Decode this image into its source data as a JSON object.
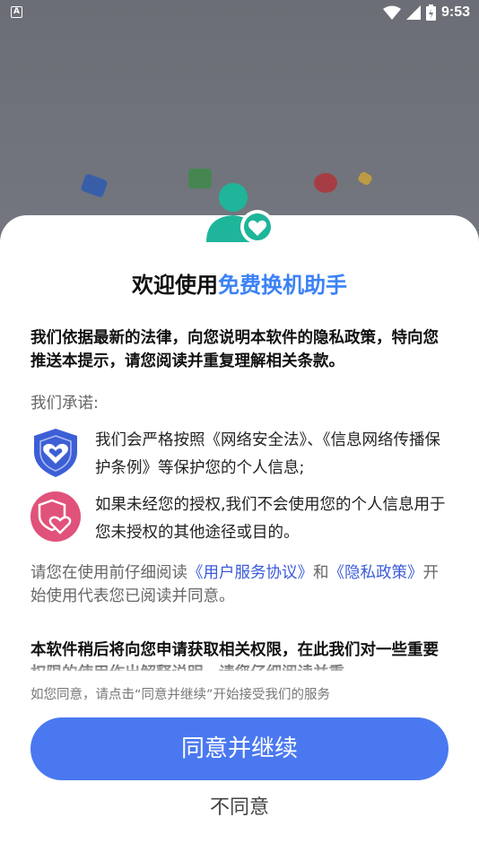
{
  "status_bar": {
    "time": "9:53",
    "notification_icon_label": "A"
  },
  "dialog": {
    "title_prefix": "欢迎使用",
    "title_app_name": "免费换机助手",
    "intro": "我们依据最新的法律，向您说明本软件的隐私政策，特向您推送本提示，请您阅读并重复理解相关条款。",
    "promise_label": "我们承诺:",
    "promises": [
      {
        "icon": "shield-heart-icon",
        "text": "我们会严格按照《网络安全法》、《信息网络传播保护条例》等保护您的个人信息;"
      },
      {
        "icon": "pink-shield-heart-icon",
        "text": "如果未经您的授权,我们不会使用您的个人信息用于您未授权的其他途径或目的。"
      }
    ],
    "read_prefix": "请您在使用前仔细阅读",
    "user_agreement_link": "《用户服务协议》",
    "and": "和",
    "privacy_link": "《隐私政策》",
    "read_suffix": "开始使用代表您已阅读并同意。",
    "permission_text": "本软件稍后将向您申请获取相关权限，在此我们对一些重要权限的使用作出解释说明，请您仔细阅读并重",
    "hint": "如您同意，请点击“同意并继续”开始接受我们的服务",
    "agree_button": "同意并继续",
    "disagree_button": "不同意"
  },
  "colors": {
    "accent": "#3b82f6",
    "button": "#4a78f0",
    "teal_icon": "#1fb59a",
    "shield_blue": "#3d5fd6",
    "pink": "#e0527a"
  }
}
